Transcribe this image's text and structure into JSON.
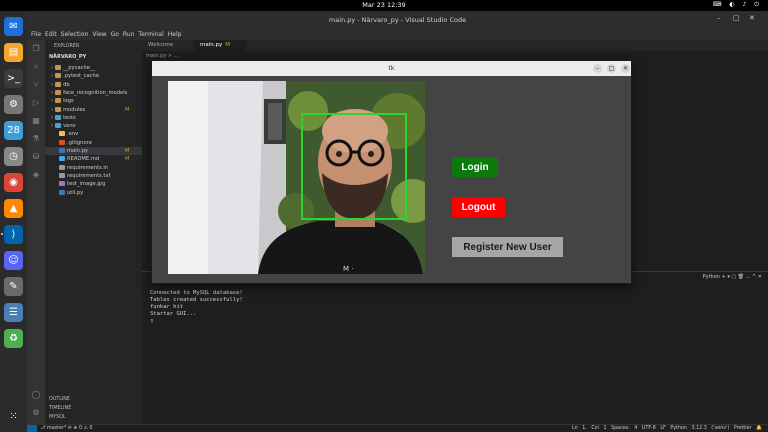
{
  "topbar": {
    "clock": "Mar 23  12:39",
    "tray": "⌨ ◐ ♪ ⏻"
  },
  "dock": {
    "apps": [
      {
        "name": "thunderbird-icon",
        "color": "#1e6fd9",
        "glyph": "✉"
      },
      {
        "name": "files-icon",
        "color": "#f4a62a",
        "glyph": "▤"
      },
      {
        "name": "terminal-icon",
        "color": "#3a3a3a",
        "glyph": ">_"
      },
      {
        "name": "settings-icon",
        "color": "#777777",
        "glyph": "⚙"
      },
      {
        "name": "calendar-icon",
        "color": "#3b9fd8",
        "glyph": "28"
      },
      {
        "name": "clock-icon",
        "color": "#888888",
        "glyph": "◷"
      },
      {
        "name": "chrome-icon",
        "color": "#db4437",
        "glyph": "◉"
      },
      {
        "name": "vlc-icon",
        "color": "#ff8800",
        "glyph": "▲"
      },
      {
        "name": "vscode-icon",
        "color": "#0065a9",
        "glyph": "⟩"
      },
      {
        "name": "discord-icon",
        "color": "#5865f2",
        "glyph": "☺"
      },
      {
        "name": "gimp-icon",
        "color": "#6b6b6b",
        "glyph": "✎"
      },
      {
        "name": "whitelist-icon",
        "color": "#4a7fb5",
        "glyph": "☰"
      },
      {
        "name": "trash-icon",
        "color": "#4caf50",
        "glyph": "♻"
      }
    ]
  },
  "vscode": {
    "title": "main.py - Närvaro_py - Visual Studio Code",
    "menu": [
      "File",
      "Edit",
      "Selection",
      "View",
      "Go",
      "Run",
      "Terminal",
      "Help"
    ],
    "explorer_header": "EXPLORER",
    "project": "NÄRVARO_PY",
    "tree": [
      {
        "label": "__pycache__",
        "type": "folder",
        "color": "#c09553"
      },
      {
        "label": ".pytest_cache",
        "type": "folder",
        "color": "#c09553"
      },
      {
        "label": "db",
        "type": "folder",
        "color": "#c09553"
      },
      {
        "label": "face_recognition_models",
        "type": "folder",
        "color": "#c09553"
      },
      {
        "label": "logs",
        "type": "folder",
        "color": "#c09553"
      },
      {
        "label": "modules",
        "type": "folder",
        "color": "#c09553",
        "badge": "M"
      },
      {
        "label": "tests",
        "type": "folder",
        "color": "#41a3d8"
      },
      {
        "label": "venv",
        "type": "folder",
        "color": "#41a3d8"
      },
      {
        "label": ".env",
        "type": "file",
        "color": "#e8c44a"
      },
      {
        "label": ".gitignore",
        "type": "file",
        "color": "#e44d26"
      },
      {
        "label": "main.py",
        "type": "file",
        "color": "#3c78aa",
        "badge": "M",
        "selected": true
      },
      {
        "label": "README.md",
        "type": "file",
        "color": "#42a5f5",
        "badge": "M"
      },
      {
        "label": "requirements.in",
        "type": "file",
        "color": "#999999"
      },
      {
        "label": "requirements.txt",
        "type": "file",
        "color": "#999999"
      },
      {
        "label": "test_image.jpg",
        "type": "file",
        "color": "#a074c4"
      },
      {
        "label": "util.py",
        "type": "file",
        "color": "#3c78aa"
      }
    ],
    "sidebar_bottom": [
      "OUTLINE",
      "TIMELINE",
      "MYSQL"
    ],
    "tabs": [
      {
        "label": "Welcome"
      },
      {
        "label": "main.py",
        "badge": "M",
        "active": true
      }
    ],
    "breadcrumb": "main.py > ...",
    "panel_tools": "Python  + ▾  ▢  🗑  ...  ^  ✕",
    "terminal_lines": [
      "Connected to MySQL database!",
      "Tables created successfully!",
      "funkar hit",
      "Startar GUI...",
      "▯"
    ],
    "status_left": "⎇ master*  ⟳  ⊗ 0 ⚠ 0",
    "status_right": "Ln 1, Col 1   Spaces: 4   UTF-8   LF   Python   3.12.3 ('venv')   Prettier   🔔"
  },
  "tk": {
    "title": "tk",
    "minimize": "–",
    "maximize": "□",
    "close": "✕",
    "login": "Login",
    "logout": "Logout",
    "register": "Register New User"
  }
}
